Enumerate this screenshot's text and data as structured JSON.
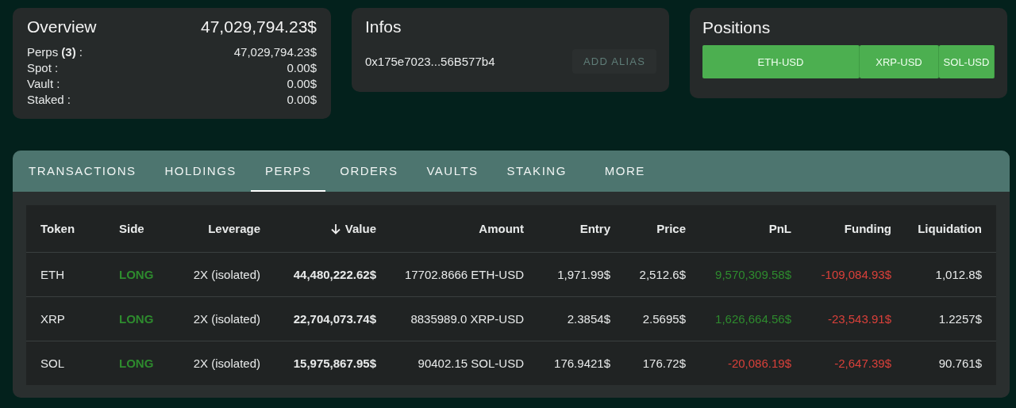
{
  "overview": {
    "title": "Overview",
    "total": "47,029,794.23$",
    "rows": [
      {
        "label": "Perps **(3)** :",
        "value": "47,029,794.23$"
      },
      {
        "label": "Spot :",
        "value": "0.00$"
      },
      {
        "label": "Vault :",
        "value": "0.00$"
      },
      {
        "label": "Staked :",
        "value": "0.00$"
      }
    ]
  },
  "infos": {
    "title": "Infos",
    "address": "0x175e7023...56B577b4",
    "button": {
      "label": "ADD ALIAS",
      "disabled": true
    }
  },
  "positions": {
    "title": "Positions",
    "items": [
      {
        "label": "ETH-USD"
      },
      {
        "label": "XRP-USD"
      },
      {
        "label": "SOL-USD"
      }
    ]
  },
  "tabs": [
    {
      "label": "TRANSACTIONS",
      "selected": false
    },
    {
      "label": "HOLDINGS",
      "selected": false
    },
    {
      "label": "PERPS",
      "selected": true
    },
    {
      "label": "ORDERS",
      "selected": false
    },
    {
      "label": "VAULTS",
      "selected": false
    },
    {
      "label": "STAKING",
      "selected": false
    },
    {
      "label": "MORE",
      "selected": false
    }
  ],
  "table": {
    "columns": [
      {
        "label": "Token",
        "sorted": false
      },
      {
        "label": "Side",
        "sorted": false
      },
      {
        "label": "Leverage",
        "sorted": false
      },
      {
        "label": "Value",
        "sorted": true
      },
      {
        "label": "Amount",
        "sorted": false
      },
      {
        "label": "Entry",
        "sorted": false
      },
      {
        "label": "Price",
        "sorted": false
      },
      {
        "label": "PnL",
        "sorted": false
      },
      {
        "label": "Funding",
        "sorted": false
      },
      {
        "label": "Liquidation",
        "sorted": false
      }
    ],
    "rows": [
      {
        "token": "ETH",
        "side": "LONG",
        "leverage": "2X (isolated)",
        "value": "44,480,222.62$",
        "amount": "17702.8666 ETH-USD",
        "entry": "1,971.99$",
        "price": "2,512.6$",
        "pnl": {
          "text": "9,570,309.58$",
          "color": "#2e8b2e"
        },
        "funding": {
          "text": "-109,084.93$",
          "color": "#d9403a"
        },
        "liquidation": "1,012.8$"
      },
      {
        "token": "XRP",
        "side": "LONG",
        "leverage": "2X (isolated)",
        "value": "22,704,073.74$",
        "amount": "8835989.0 XRP-USD",
        "entry": "2.3854$",
        "price": "2.5695$",
        "pnl": {
          "text": "1,626,664.56$",
          "color": "#2e8b2e"
        },
        "funding": {
          "text": "-23,543.91$",
          "color": "#d9403a"
        },
        "liquidation": "1.2257$"
      },
      {
        "token": "SOL",
        "side": "LONG",
        "leverage": "2X (isolated)",
        "value": "15,975,867.95$",
        "amount": "90402.15 SOL-USD",
        "entry": "176.9421$",
        "price": "176.72$",
        "pnl": {
          "text": "-20,086.19$",
          "color": "#d9403a"
        },
        "funding": {
          "text": "-2,647.39$",
          "color": "#d9403a"
        },
        "liquidation": "90.761$"
      }
    ]
  }
}
